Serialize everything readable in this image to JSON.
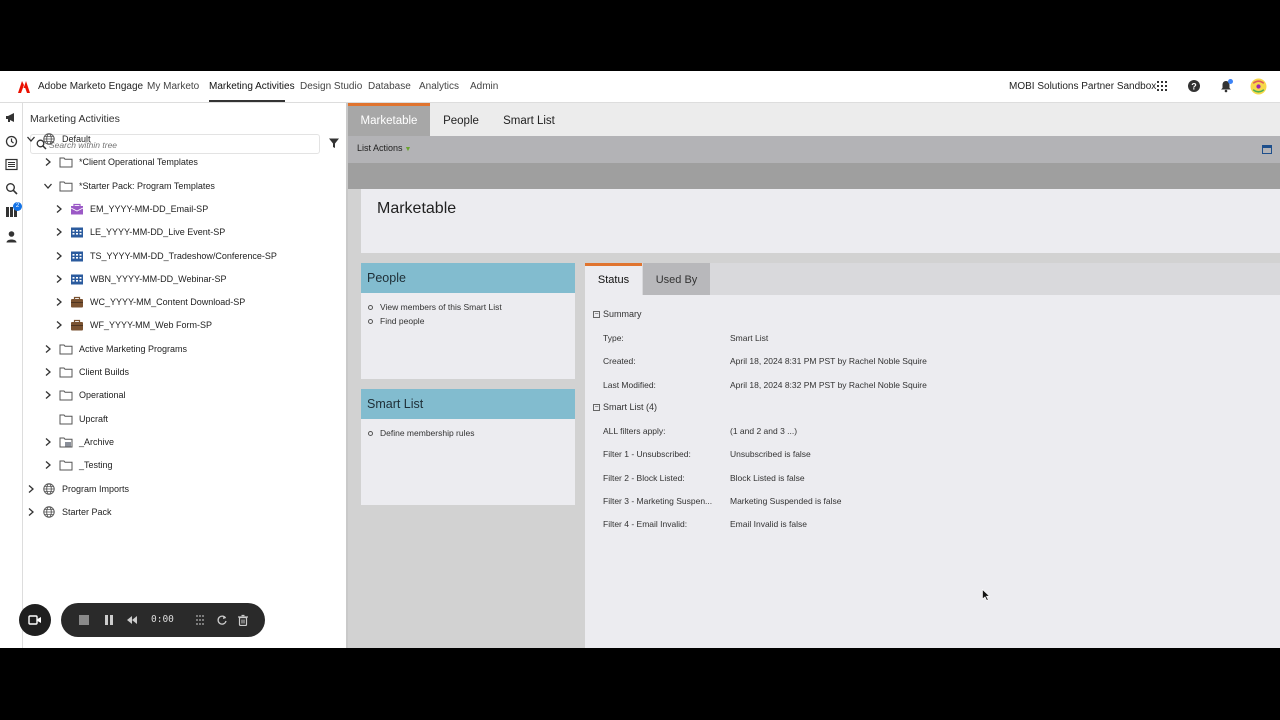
{
  "topnav": {
    "brand": "Adobe Marketo Engage",
    "items": [
      "My Marketo",
      "Marketing Activities",
      "Design Studio",
      "Database",
      "Analytics",
      "Admin"
    ],
    "active": "Marketing Activities",
    "instance": "MOBI Solutions Partner Sandbox",
    "icons": [
      "app-grid-icon",
      "help-icon",
      "bell-icon",
      "avatar"
    ]
  },
  "rail": {
    "icons": [
      "megaphone-icon",
      "history-icon",
      "list-icon",
      "search-icon",
      "library-icon",
      "person-icon"
    ],
    "badge": "2"
  },
  "tree": {
    "title": "Marketing Activities",
    "search_placeholder": "Search within tree",
    "nodes": [
      {
        "label": "Default",
        "type": "globe",
        "level": 0,
        "state": "open"
      },
      {
        "label": "*Client Operational Templates",
        "type": "folder",
        "level": 1,
        "state": "closed"
      },
      {
        "label": "*Starter Pack: Program Templates",
        "type": "folder",
        "level": 1,
        "state": "open"
      },
      {
        "label": "EM_YYYY-MM-DD_Email-SP",
        "type": "email-program",
        "level": 2,
        "state": "closed"
      },
      {
        "label": "LE_YYYY-MM-DD_Live Event-SP",
        "type": "event-program",
        "level": 2,
        "state": "closed"
      },
      {
        "label": "TS_YYYY-MM-DD_Tradeshow/Conference-SP",
        "type": "event-program",
        "level": 2,
        "state": "closed"
      },
      {
        "label": "WBN_YYYY-MM-DD_Webinar-SP",
        "type": "event-program",
        "level": 2,
        "state": "closed"
      },
      {
        "label": "WC_YYYY-MM_Content Download-SP",
        "type": "default-program",
        "level": 2,
        "state": "closed"
      },
      {
        "label": "WF_YYYY-MM_Web Form-SP",
        "type": "default-program",
        "level": 2,
        "state": "closed"
      },
      {
        "label": "Active Marketing Programs",
        "type": "folder",
        "level": 1,
        "state": "closed"
      },
      {
        "label": "Client Builds",
        "type": "folder",
        "level": 1,
        "state": "closed"
      },
      {
        "label": "Operational",
        "type": "folder",
        "level": 1,
        "state": "closed"
      },
      {
        "label": "Upcraft",
        "type": "folder",
        "level": 1,
        "state": "none"
      },
      {
        "label": "_Archive",
        "type": "archive-folder",
        "level": 1,
        "state": "closed"
      },
      {
        "label": "_Testing",
        "type": "folder",
        "level": 1,
        "state": "closed"
      },
      {
        "label": "Program Imports",
        "type": "globe",
        "level": 0,
        "state": "closed"
      },
      {
        "label": "Starter Pack",
        "type": "globe",
        "level": 0,
        "state": "closed"
      }
    ]
  },
  "main": {
    "tabs": [
      "Marketable",
      "People",
      "Smart List"
    ],
    "active_tab": "Marketable",
    "list_actions": "List Actions",
    "title": "Marketable",
    "people_card": {
      "title": "People",
      "links": [
        "View members of this Smart List",
        "Find people"
      ]
    },
    "smartlist_card": {
      "title": "Smart List",
      "links": [
        "Define membership rules"
      ]
    },
    "detail_tabs": [
      "Status",
      "Used By"
    ],
    "summary": {
      "heading": "Summary",
      "rows": [
        {
          "label": "Type:",
          "value": "Smart List"
        },
        {
          "label": "Created:",
          "value": "April 18, 2024 8:31 PM PST by Rachel Noble Squire"
        },
        {
          "label": "Last Modified:",
          "value": "April 18, 2024 8:32 PM PST by Rachel Noble Squire"
        }
      ]
    },
    "smart_list": {
      "heading": "Smart List (4)",
      "rows": [
        {
          "label": "ALL filters apply:",
          "value": "(1 and 2 and 3 ...)"
        },
        {
          "label": "Filter 1 - Unsubscribed:",
          "value": "Unsubscribed is false"
        },
        {
          "label": "Filter 2 - Block Listed:",
          "value": "Block Listed is false"
        },
        {
          "label": "Filter 3 - Marketing Suspen...",
          "value": "Marketing Suspended is false"
        },
        {
          "label": "Filter 4 - Email Invalid:",
          "value": "Email Invalid is false"
        }
      ]
    }
  },
  "recorder": {
    "timer": "0:00"
  },
  "colors": {
    "accent_orange": "#e0742f",
    "card_header_blue": "#82bccf",
    "adobe_red": "#eb1000"
  }
}
